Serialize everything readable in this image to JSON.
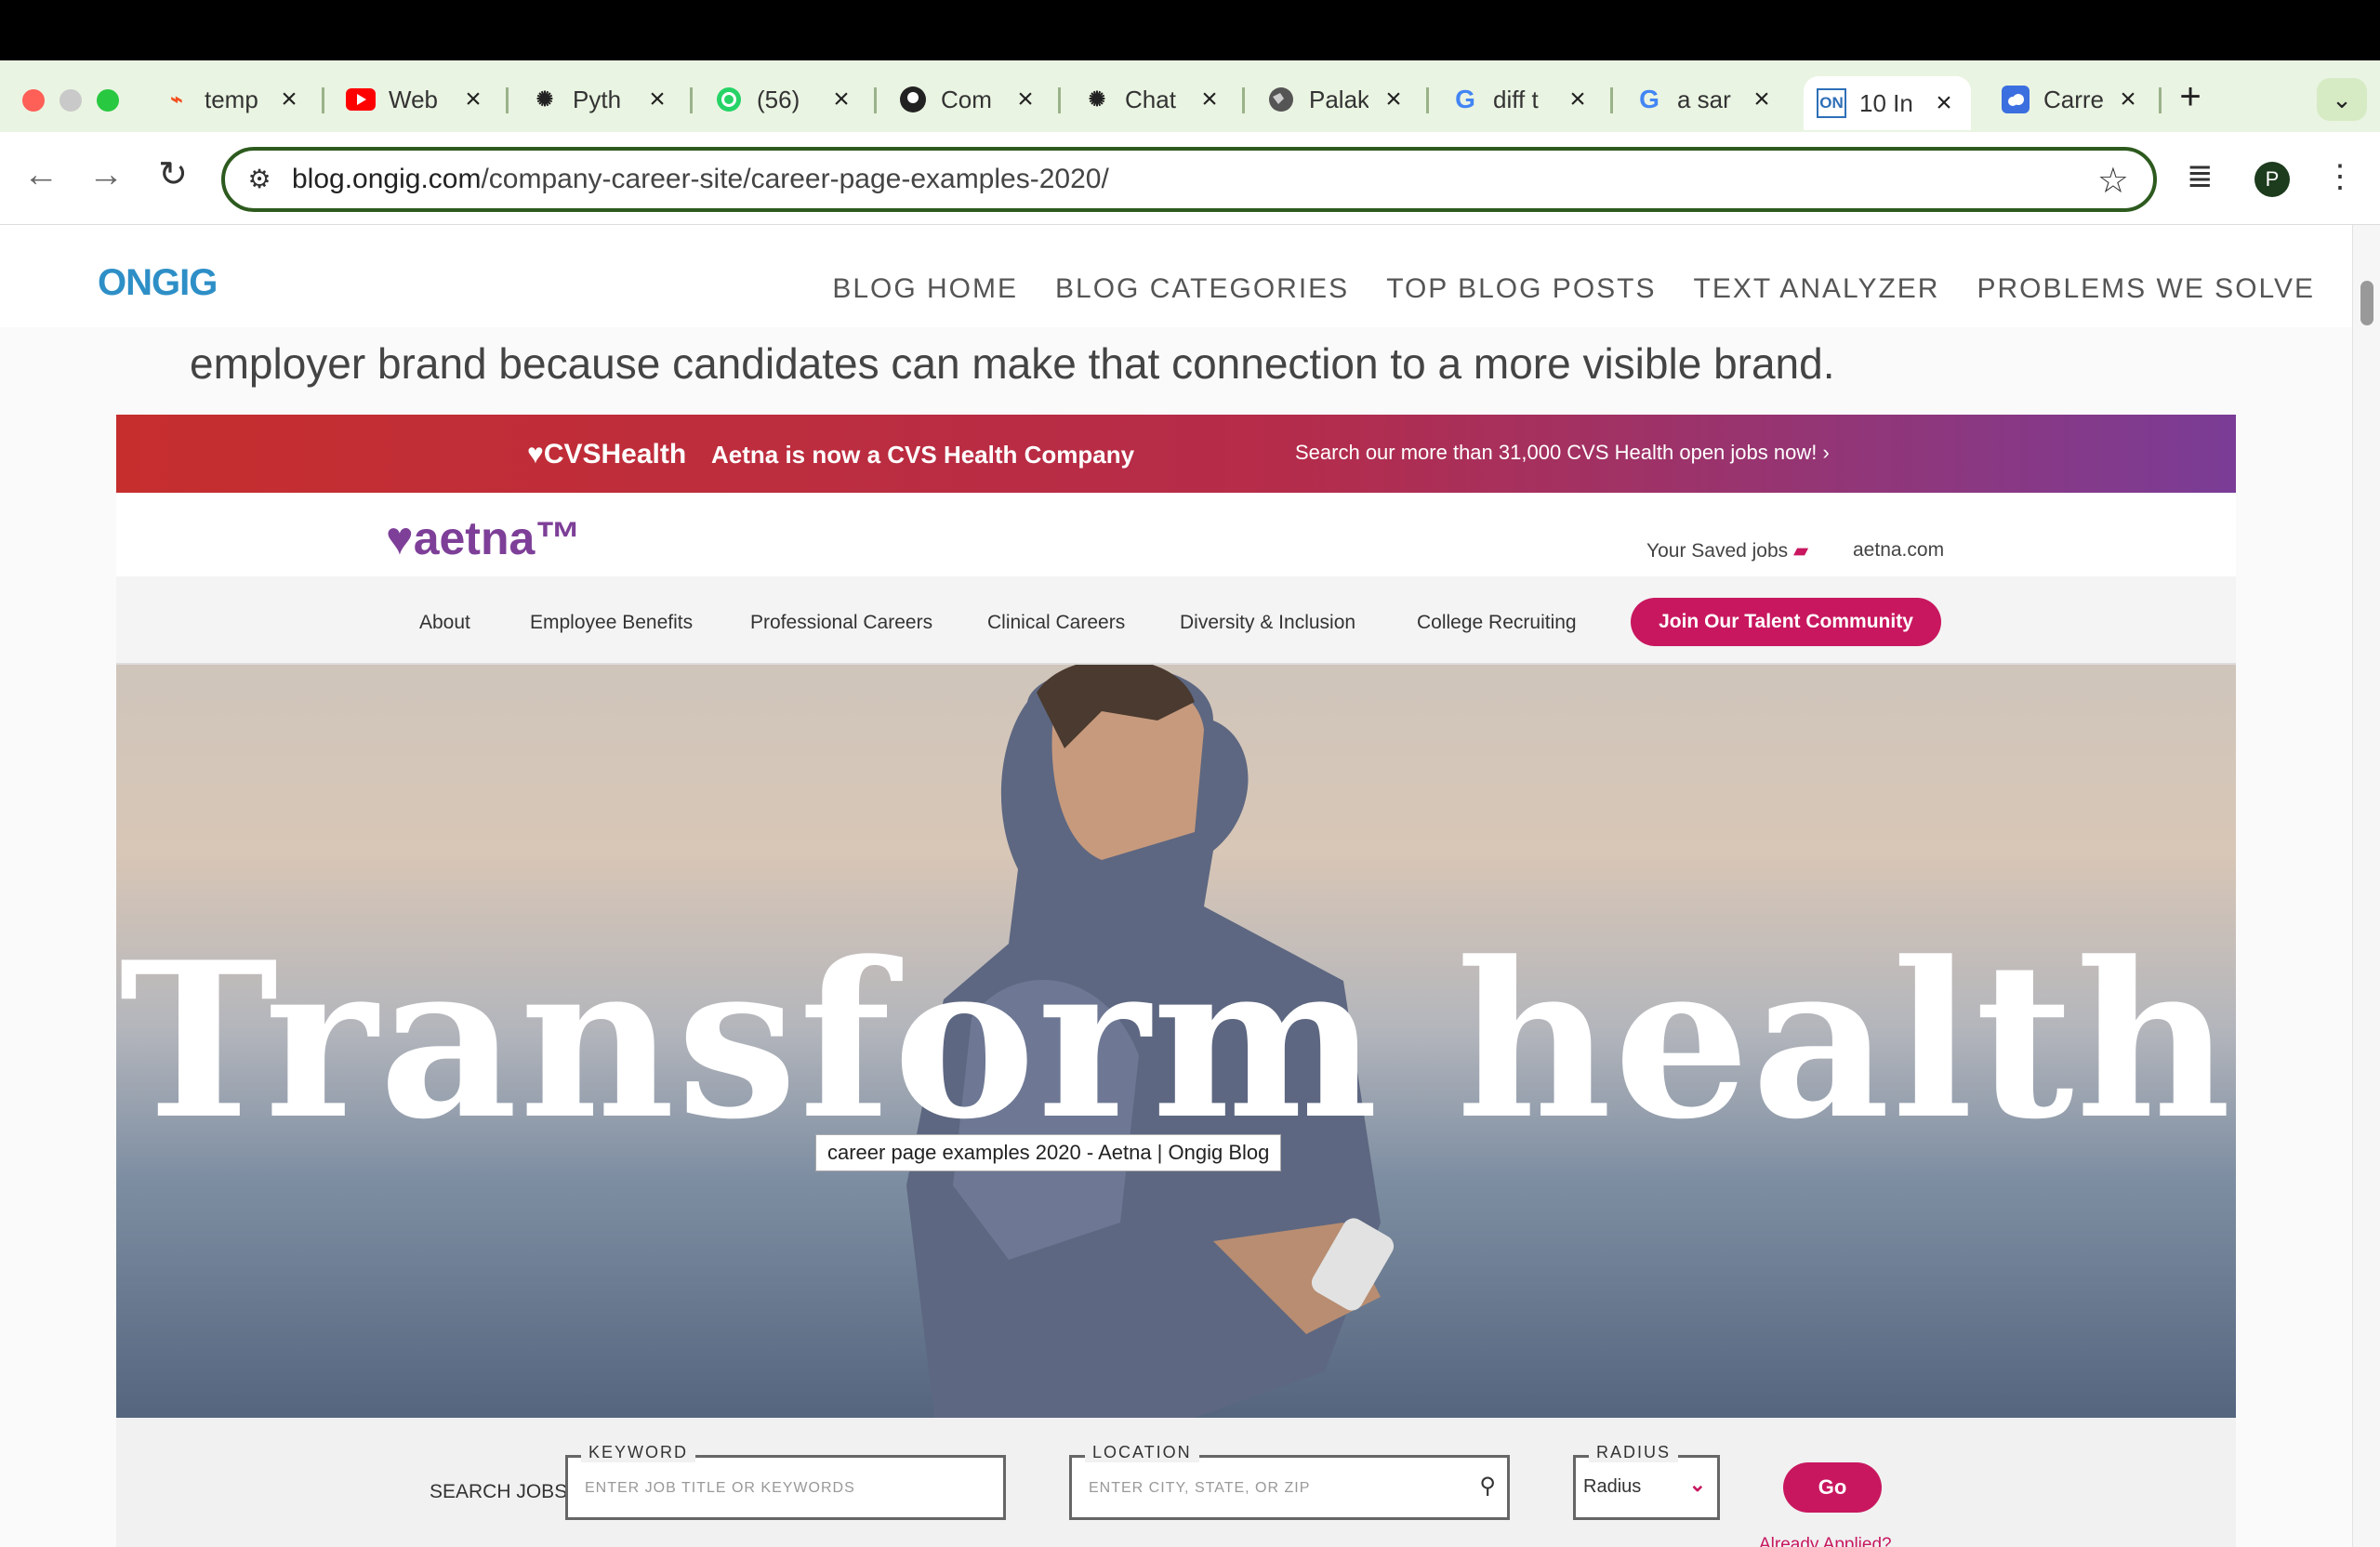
{
  "browser": {
    "tabs": [
      {
        "title": "temp",
        "icon": "figma-like-icon"
      },
      {
        "title": "Web",
        "icon": "youtube-icon"
      },
      {
        "title": "Pyth",
        "icon": "openai-icon"
      },
      {
        "title": "(56)",
        "icon": "whatsapp-icon"
      },
      {
        "title": "Com",
        "icon": "github-icon"
      },
      {
        "title": "Chat",
        "icon": "openai-icon"
      },
      {
        "title": "Palak",
        "icon": "globe-icon"
      },
      {
        "title": "diff t",
        "icon": "google-icon"
      },
      {
        "title": "a sar",
        "icon": "google-icon"
      },
      {
        "title": "10 In",
        "icon": "ongig-icon",
        "active": true
      },
      {
        "title": "Carre",
        "icon": "cloud-icon"
      }
    ],
    "url_domain": "blog.ongig.com",
    "url_path": "/company-career-site/career-page-examples-2020/",
    "profile_initial": "P"
  },
  "site": {
    "logo": "ONGIG",
    "nav": [
      "BLOG HOME",
      "BLOG CATEGORIES",
      "TOP BLOG POSTS",
      "TEXT ANALYZER",
      "PROBLEMS WE SOLVE"
    ],
    "intro_text": "employer brand because candidates can make that connection to a more visible brand."
  },
  "aetna": {
    "cvs_logo": "♥CVSHealth",
    "cvs_message": "Aetna is now a CVS Health Company",
    "cvs_link": "Search our more than 31,000 CVS Health open jobs now! ›",
    "logo": "♥aetna™",
    "saved_jobs": "Your Saved jobs",
    "aetna_com": "aetna.com",
    "nav": [
      "About",
      "Employee Benefits",
      "Professional Careers",
      "Clinical Careers",
      "Diversity & Inclusion",
      "College Recruiting"
    ],
    "join_button": "Join Our Talent Community",
    "hero_title": "Transform health",
    "tooltip": "career page examples 2020 - Aetna | Ongig Blog",
    "search": {
      "label": "SEARCH JOBS",
      "keyword_legend": "KEYWORD",
      "keyword_placeholder": "ENTER JOB TITLE OR KEYWORDS",
      "location_legend": "LOCATION",
      "location_placeholder": "ENTER CITY, STATE, OR ZIP",
      "radius_legend": "RADIUS",
      "radius_value": "Radius",
      "go": "Go",
      "already_applied": "Already Applied?"
    }
  }
}
